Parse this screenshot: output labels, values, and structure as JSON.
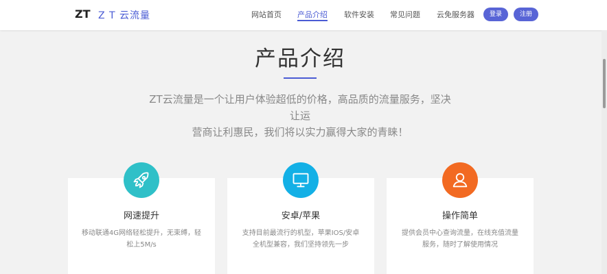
{
  "header": {
    "logo_mark": "ZT",
    "logo_text": "Z T 云流量",
    "nav": [
      {
        "label": "网站首页"
      },
      {
        "label": "产品介绍",
        "active": true
      },
      {
        "label": "软件安装"
      },
      {
        "label": "常见问题"
      },
      {
        "label": "云免服务器"
      }
    ],
    "login_label": "登录",
    "register_label": "注册"
  },
  "section": {
    "title": "产品介绍",
    "intro_line1": "ZT云流量是一个让用户体验超低的价格，高品质的流量服务，坚决让运",
    "intro_line2": "营商让利惠民，我们将以实力赢得大家的青睐！"
  },
  "cards": [
    {
      "title": "网速提升",
      "desc": "移动联通4G网络轻松提升，无束缚，轻松上5M/s",
      "icon": "rocket-icon",
      "color": "#2fc0c8"
    },
    {
      "title": "安卓/苹果",
      "desc": "支持目前最流行的机型，苹果IOS/安卓全机型兼容，我们坚持领先一步",
      "icon": "monitor-icon",
      "color": "#13b0e6"
    },
    {
      "title": "操作简单",
      "desc": "提供会员中心查询流量，在线充值流量服务，随时了解使用情况",
      "icon": "user-icon",
      "color": "#f26a22"
    }
  ],
  "colors": {
    "accent": "#4a5bd4",
    "button": "#5864d6"
  }
}
